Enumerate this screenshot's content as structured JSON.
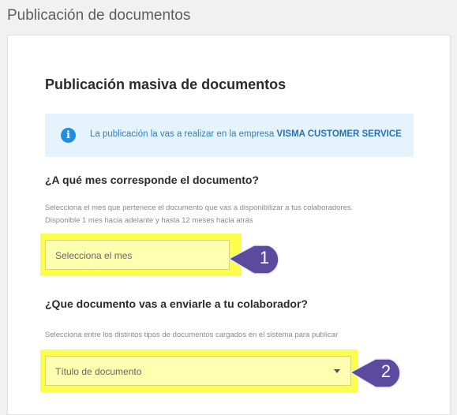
{
  "page": {
    "title": "Publicación de documentos"
  },
  "card": {
    "title": "Publicación masiva de documentos",
    "info": {
      "icon": "info-icon",
      "text": "La publicación la vas a realizar en la empresa ",
      "company": "VISMA CUSTOMER SERVICE"
    },
    "month_section": {
      "question": "¿A qué mes corresponde el documento?",
      "helper_line1": "Selecciona el mes que pertenece el documento que vas a disponibilizar a tus colaboradores.",
      "helper_line2": "Disponible 1 mes hacia adelante y hasta 12 meses hacia atrás",
      "field_placeholder": "Selecciona el mes"
    },
    "doc_section": {
      "question": "¿Que documento vas a enviarle a tu colaborador?",
      "helper": "Selecciona entre los distintos tipos de documentos cargados en el sistema para publicar",
      "field_placeholder": "Título de documento",
      "dropdown_icon": "chevron-down-icon"
    }
  },
  "annotations": [
    {
      "label": "1"
    },
    {
      "label": "2"
    }
  ],
  "colors": {
    "highlight": "#fdfd4d",
    "callout": "#5b4b9e",
    "info_bg": "#e5f3fd",
    "info_accent": "#1f8fe5"
  }
}
